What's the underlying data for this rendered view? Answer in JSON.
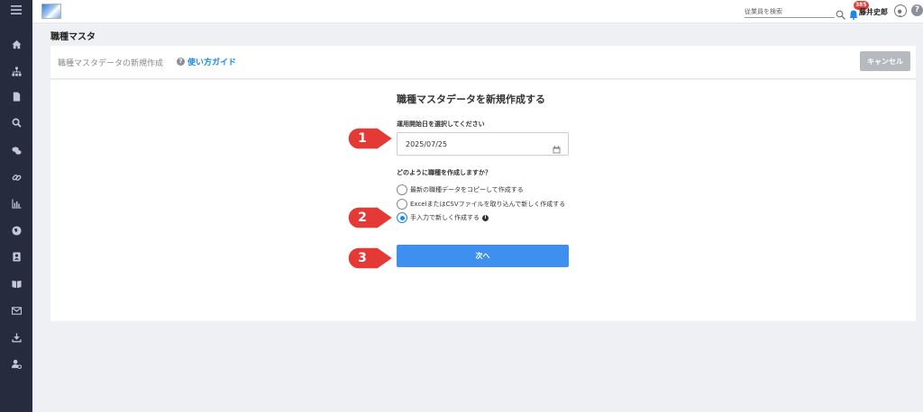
{
  "sidebar": {
    "icons": [
      "menu-icon",
      "home-icon",
      "org-chart-icon",
      "document-icon",
      "search-icon",
      "chat-icon",
      "link-icon",
      "chart-icon",
      "globe-icon",
      "contact-icon",
      "book-icon",
      "mail-icon",
      "download-icon",
      "user-settings-icon"
    ]
  },
  "header": {
    "search_placeholder": "従業員を検索",
    "notification_count": "385",
    "user_name": "藤井史郎",
    "help_label": "?"
  },
  "page": {
    "title": "職種マスタ"
  },
  "subheader": {
    "label": "職種マスタデータの新規作成",
    "guide_icon": "?",
    "guide_link": "使い方ガイド",
    "cancel_label": "キャンセル"
  },
  "form": {
    "title": "職種マスタデータを新規作成する",
    "date_label": "運用開始日を選択してください",
    "date_value": "2025/07/25",
    "question_label": "どのように職種を作成しますか？",
    "options": [
      {
        "label": "最新の職種データをコピーして作成する",
        "checked": false
      },
      {
        "label": "ExcelまたはCSVファイルを取り込んで新しく作成する",
        "checked": false
      },
      {
        "label": "手入力で新しく作成する",
        "checked": true
      }
    ],
    "info_icon": "i",
    "next_label": "次へ"
  },
  "callouts": [
    {
      "number": "1"
    },
    {
      "number": "2"
    },
    {
      "number": "3"
    }
  ],
  "colors": {
    "sidebar_bg": "#262c3d",
    "primary": "#3d8ff0",
    "callout_red": "#e53935",
    "cancel_bg": "#b6b9be",
    "link": "#1e88e5"
  }
}
